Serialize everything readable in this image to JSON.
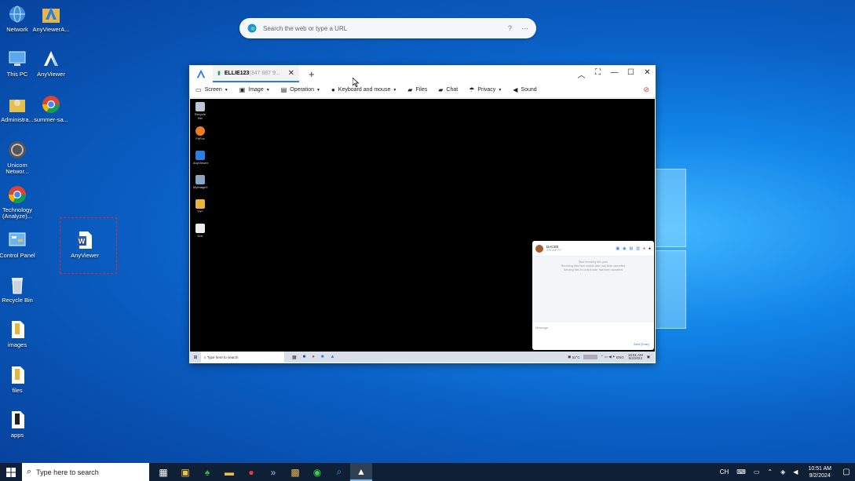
{
  "desktop": {
    "icons": [
      {
        "label": "Network"
      },
      {
        "label": "AnyViewerA..."
      },
      {
        "label": "This PC"
      },
      {
        "label": "AnyViewer"
      },
      {
        "label": "Administra..."
      },
      {
        "label": "summer-sa..."
      },
      {
        "label": "Unicom Networ..."
      },
      {
        "label": "Technology (Analyze)..."
      },
      {
        "label": "Control Panel"
      },
      {
        "label": "AnyViewer"
      },
      {
        "label": "Recycle Bin"
      },
      {
        "label": "images"
      },
      {
        "label": "files"
      },
      {
        "label": "apps"
      }
    ]
  },
  "browser_search": {
    "placeholder": "Search the web or type a URL"
  },
  "anyviewer": {
    "tab": {
      "name": "ELLIE123",
      "id": "(347 887 9..."
    },
    "toolbar": {
      "screen": "Screen",
      "image": "Image",
      "operation": "Operation",
      "keyboard_mouse": "Keyboard and mouse",
      "files": "Files",
      "chat": "Chat",
      "privacy": "Privacy",
      "sound": "Sound"
    },
    "remote": {
      "icons": [
        "Recycle Bin",
        "FirFox",
        "AnyViewer",
        "MyImage1",
        "\"PP\"",
        "Doc"
      ],
      "taskbar_search": "Type here to search",
      "tray_temp": "52°C",
      "tray_lang": "ENG",
      "tray_time": "10:51 AM",
      "tray_date": "9/2/2024",
      "chat": {
        "user": "DACEE",
        "user_id": "378 498 777",
        "line1": "Start receiving this point",
        "line2": "Receiving files from control side: has been cancelled",
        "line3": "Sending files to control side: has been cancelled",
        "input_placeholder": "Message...",
        "send": "Send (Enter)"
      }
    }
  },
  "taskbar": {
    "search_placeholder": "Type here to search",
    "tray_lang": "CH",
    "time": "10:51 AM",
    "date": "9/2/2024"
  }
}
